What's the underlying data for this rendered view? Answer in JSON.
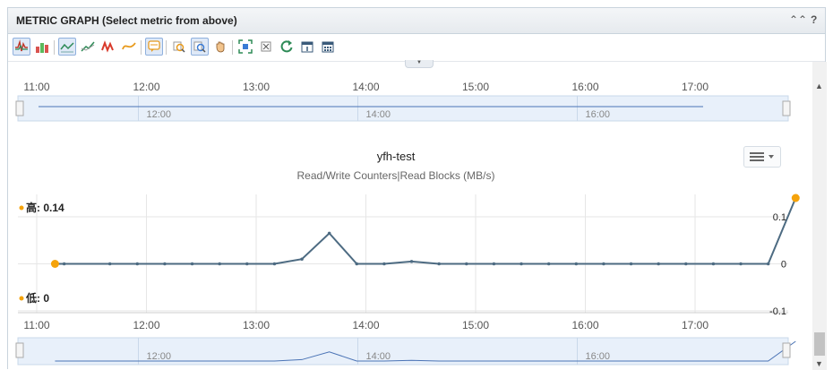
{
  "panel": {
    "title": "METRIC GRAPH (Select metric from above)",
    "collapse_icon": "double-chevron-up-icon",
    "help_label": "?"
  },
  "toolbar": {
    "buttons": [
      {
        "icon": "line-graph-icon",
        "active": true
      },
      {
        "icon": "area-graph-icon",
        "active": false
      },
      {
        "icon": "line-mode-icon",
        "active": true
      },
      {
        "icon": "trend-icon",
        "active": false
      },
      {
        "icon": "spike-icon",
        "active": false
      },
      {
        "icon": "smooth-curve-icon",
        "active": false
      },
      {
        "icon": "comment-icon",
        "active": true
      },
      {
        "icon": "zoom-out-icon",
        "active": false
      },
      {
        "icon": "zoom-in-icon",
        "active": true
      },
      {
        "icon": "pan-hand-icon",
        "active": false
      },
      {
        "icon": "fit-to-screen-icon",
        "active": false
      },
      {
        "icon": "reset-zoom-icon",
        "active": false
      },
      {
        "icon": "refresh-icon",
        "active": false
      },
      {
        "icon": "single-day-calendar-icon",
        "active": false
      },
      {
        "icon": "calendar-icon",
        "active": false
      }
    ]
  },
  "top_navigator": {
    "axis_ticks": [
      "11:00",
      "12:00",
      "13:00",
      "14:00",
      "15:00",
      "16:00",
      "17:00"
    ],
    "inner_ticks": [
      "12:00",
      "14:00",
      "16:00"
    ]
  },
  "chart_data": {
    "type": "line",
    "title": "yfh-test",
    "subtitle": "Read/Write Counters|Read Blocks (MB/s)",
    "x_ticks": [
      "11:00",
      "12:00",
      "13:00",
      "14:00",
      "15:00",
      "16:00",
      "17:00"
    ],
    "y_ticks": [
      "0.1",
      "0",
      "-0.1"
    ],
    "ylim": [
      -0.1,
      0.14
    ],
    "high_label": "高: 0.14",
    "low_label": "低: 0",
    "high_value": 0.14,
    "low_value": 0,
    "series": [
      {
        "color": "#4d6b82",
        "x": [
          "11:10",
          "11:15",
          "11:40",
          "11:55",
          "12:10",
          "12:25",
          "12:40",
          "12:55",
          "13:10",
          "13:25",
          "13:40",
          "13:55",
          "14:10",
          "14:25",
          "14:40",
          "14:55",
          "15:10",
          "15:25",
          "15:40",
          "15:55",
          "16:10",
          "16:25",
          "16:40",
          "16:55",
          "17:10",
          "17:25",
          "17:40",
          "17:55"
        ],
        "values": [
          0,
          0,
          0,
          0,
          0,
          0,
          0,
          0,
          0,
          0.01,
          0.065,
          0,
          0,
          0.005,
          0,
          0,
          0,
          0,
          0,
          0,
          0,
          0,
          0,
          0,
          0,
          0,
          0,
          0.14
        ]
      }
    ],
    "high_point_color": "#f5a30b"
  },
  "bottom_navigator": {
    "axis_ticks": [
      "11:00",
      "12:00",
      "13:00",
      "14:00",
      "15:00",
      "16:00",
      "17:00"
    ],
    "inner_ticks": [
      "12:00",
      "14:00",
      "16:00"
    ]
  },
  "scrollbar": {
    "up_icon": "scroll-up-arrow-icon",
    "down_icon": "scroll-down-arrow-icon"
  },
  "chart_menu": {
    "icon": "hamburger-menu-icon"
  }
}
